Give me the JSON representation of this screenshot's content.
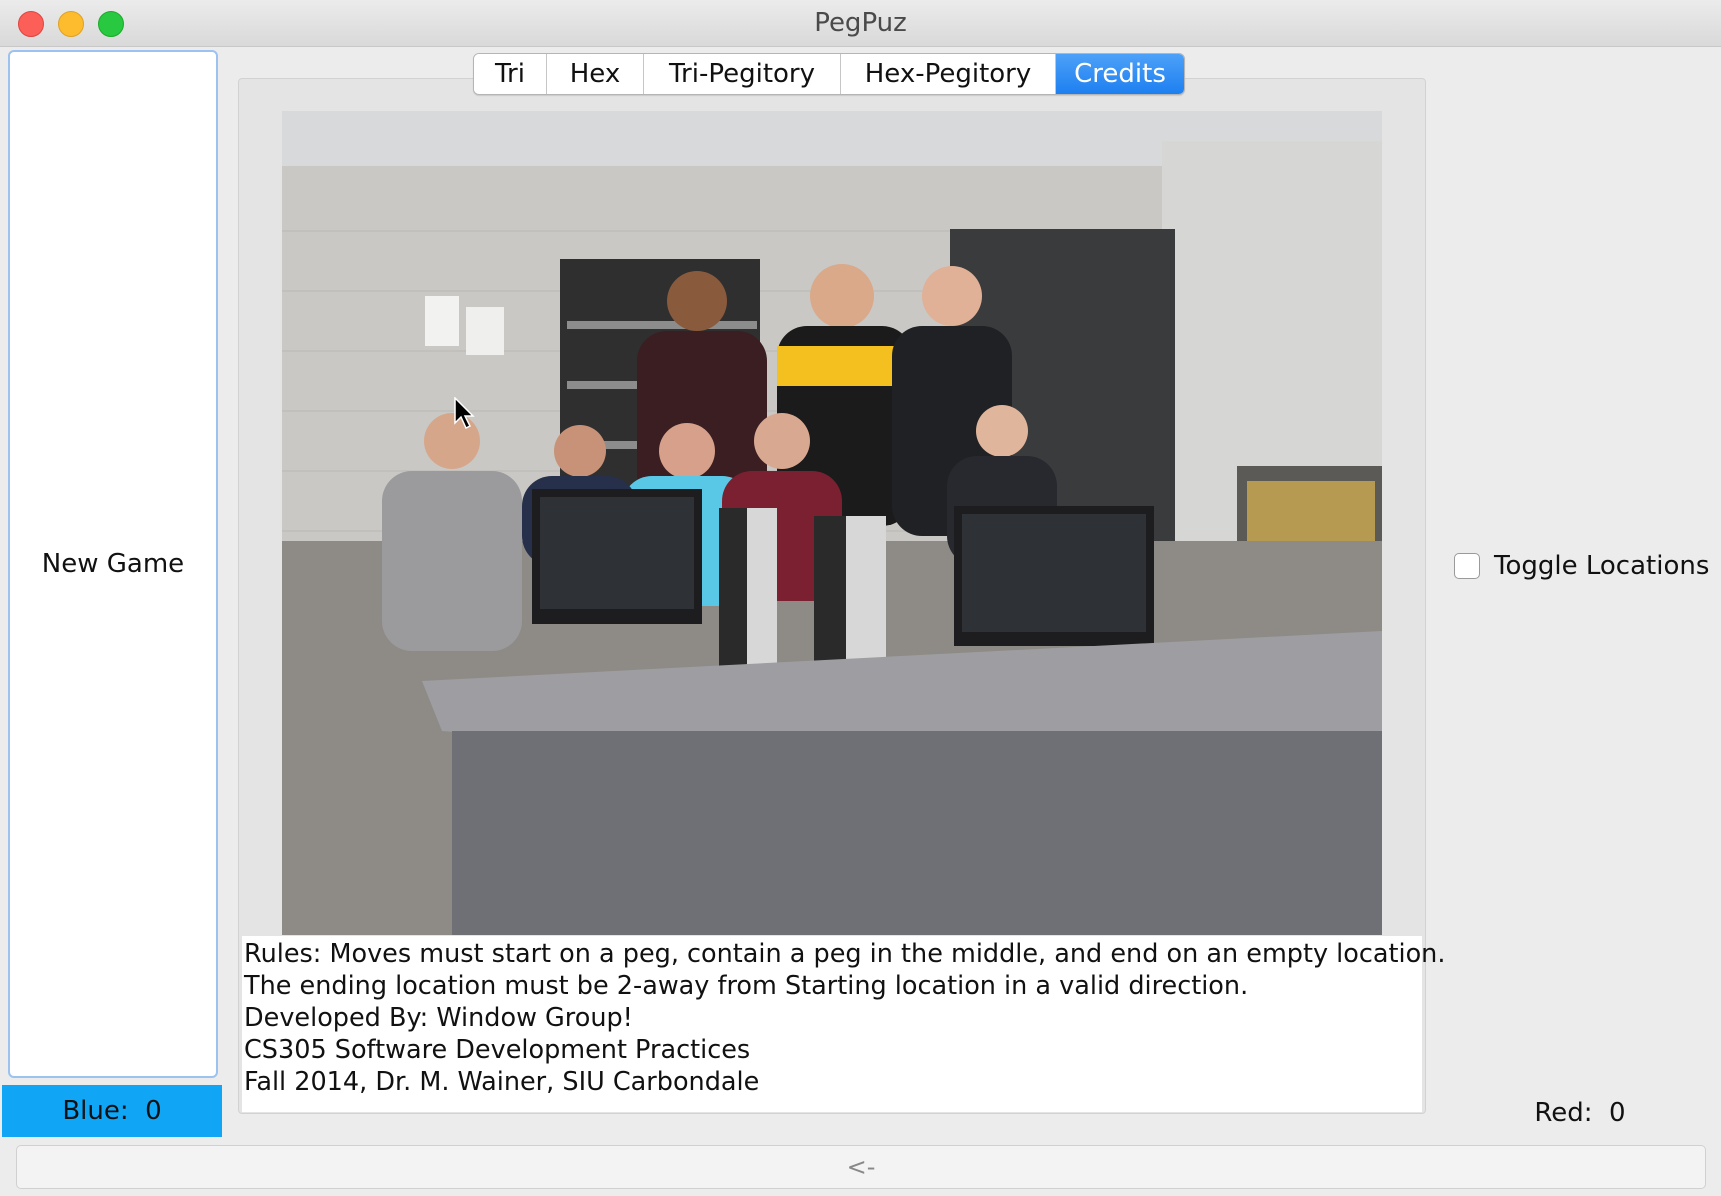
{
  "window": {
    "title": "PegPuz"
  },
  "tabs": [
    {
      "label": "Tri",
      "active": false
    },
    {
      "label": "Hex",
      "active": false
    },
    {
      "label": "Tri-Pegitory",
      "active": false
    },
    {
      "label": "Hex-Pegitory",
      "active": false
    },
    {
      "label": "Credits",
      "active": true
    }
  ],
  "left_panel": {
    "new_game_label": "New Game",
    "blue_score": "Blue:  0"
  },
  "right_panel": {
    "toggle_label": "Toggle Locations",
    "toggle_checked": false,
    "red_score": "Red:  0"
  },
  "credits": {
    "rules_lines": [
      "Rules: Moves must start on a peg, contain a peg in the middle, and end on an empty location.",
      "The ending location must be 2-away from Starting location in a valid direction.",
      "Developed By: Window Group!",
      "CS305 Software Development Practices",
      "Fall 2014, Dr. M. Wainer, SIU Carbondale"
    ]
  },
  "bottom_bar": {
    "back_label": "<-"
  },
  "colors": {
    "accent": "#1d7ff0",
    "blue_score_bg": "#10a5f5"
  }
}
